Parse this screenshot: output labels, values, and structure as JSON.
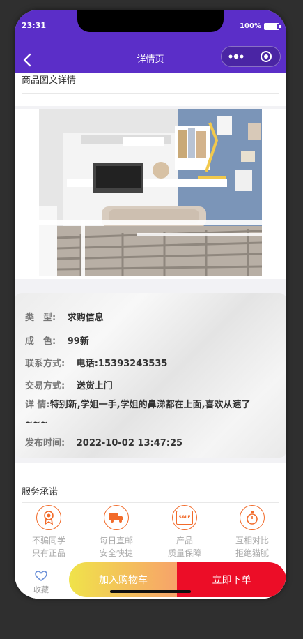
{
  "status": {
    "time": "23:31",
    "battery": "100%"
  },
  "header": {
    "title": "详情页"
  },
  "sections": {
    "detail_title": "商品图文详情",
    "service_title": "服务承诺"
  },
  "info": [
    {
      "label": "类　型:",
      "value": "求购信息"
    },
    {
      "label": "成　色:",
      "value": "99新"
    },
    {
      "label": "联系方式:",
      "value": "电话:15393243535"
    },
    {
      "label": "交易方式:",
      "value": "送货上门"
    },
    {
      "label": "详 情:",
      "value": "特别新,学姐一手,学姐的鼻涕都在上面,喜欢从速了~~~"
    },
    {
      "label": "发布时间:",
      "value": "2022-10-02 13:47:25"
    }
  ],
  "services": [
    {
      "line1": "不骗同学",
      "line2": "只有正品",
      "icon": "medal-icon"
    },
    {
      "line1": "每日直邮",
      "line2": "安全快捷",
      "icon": "truck-icon"
    },
    {
      "line1": "产品",
      "line2": "质量保障",
      "icon": "sale-tag-icon",
      "badge": "SALE"
    },
    {
      "line1": "互相对比",
      "line2": "拒绝猫腻",
      "icon": "stopwatch-icon"
    }
  ],
  "bottom": {
    "favorite": "收藏",
    "add_cart": "加入购物车",
    "buy_now": "立即下单"
  },
  "colors": {
    "header": "#5b2ec8",
    "accent": "#f26b2a",
    "buy": "#ec0d27"
  }
}
